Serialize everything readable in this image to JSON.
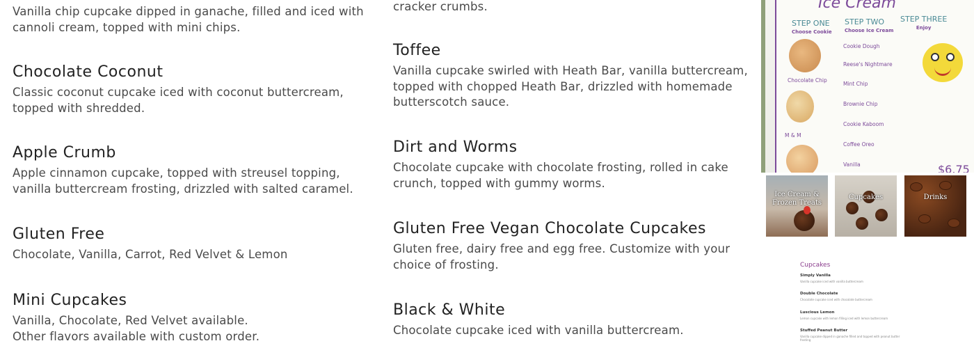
{
  "left_items": [
    {
      "title": "",
      "desc": "Vanilla chip cupcake dipped in ganache, filled and iced with cannoli cream, topped with mini chips."
    },
    {
      "title": "Chocolate Coconut",
      "desc": "Classic coconut cupcake iced with coconut buttercream, topped with shredded."
    },
    {
      "title": "Apple Crumb",
      "desc": "Apple cinnamon cupcake, topped with streusel topping, vanilla buttercream frosting, drizzled with salted caramel."
    },
    {
      "title": "Gluten Free",
      "desc": "Chocolate, Vanilla, Carrot, Red Velvet & Lemon"
    },
    {
      "title": "Mini Cupcakes",
      "desc": "Vanilla, Chocolate, Red Velvet available.\nOther flavors available with custom order."
    }
  ],
  "mid_items": [
    {
      "title": "",
      "desc": "cracker crumbs."
    },
    {
      "title": "Toffee",
      "desc": "Vanilla cupcake swirled with Heath Bar, vanilla buttercream, topped with chopped Heath Bar, drizzled with homemade butterscotch sauce."
    },
    {
      "title": "Dirt and Worms",
      "desc": "Chocolate cupcake with chocolate frosting, rolled in cake crunch, topped with gummy worms."
    },
    {
      "title": "Gluten Free Vegan Chocolate Cupcakes",
      "desc": "Gluten free, dairy free and egg free. Customize with your choice of frosting."
    },
    {
      "title": "Black & White",
      "desc": "Chocolate cupcake iced with vanilla buttercream."
    }
  ],
  "menu_board": {
    "heading": "Ice Cream",
    "steps": [
      {
        "label": "STEP ONE",
        "sub": "Choose Cookie"
      },
      {
        "label": "STEP TWO",
        "sub": "Choose Ice Cream"
      },
      {
        "label": "STEP THREE",
        "sub": "Enjoy"
      }
    ],
    "cookie_labels": [
      "Chocolate Chip",
      "M & M"
    ],
    "flavors": [
      "Cookie Dough",
      "Reese's Nightmare",
      "Mint Chip",
      "Brownie Chip",
      "Cookie Kaboom",
      "Coffee Oreo",
      "Vanilla"
    ],
    "price": "$6.75"
  },
  "thumbnails": [
    {
      "label": "Ice Cream & Frozen Treats"
    },
    {
      "label": "Cupcakes"
    },
    {
      "label": "Drinks"
    }
  ],
  "mini_menu": {
    "title": "Cupcakes",
    "items": [
      {
        "name": "Simply Vanilla",
        "desc": "Vanilla cupcake iced with vanilla buttercream"
      },
      {
        "name": "Double Chocolate",
        "desc": "Chocolate cupcake iced with chocolate buttercream"
      },
      {
        "name": "Luscious Lemon",
        "desc": "Lemon cupcake with lemon filling iced with lemon buttercream"
      },
      {
        "name": "Stuffed Peanut Butter",
        "desc": "Vanilla cupcake dipped in ganache filled and topped with peanut butter frosting"
      }
    ]
  }
}
